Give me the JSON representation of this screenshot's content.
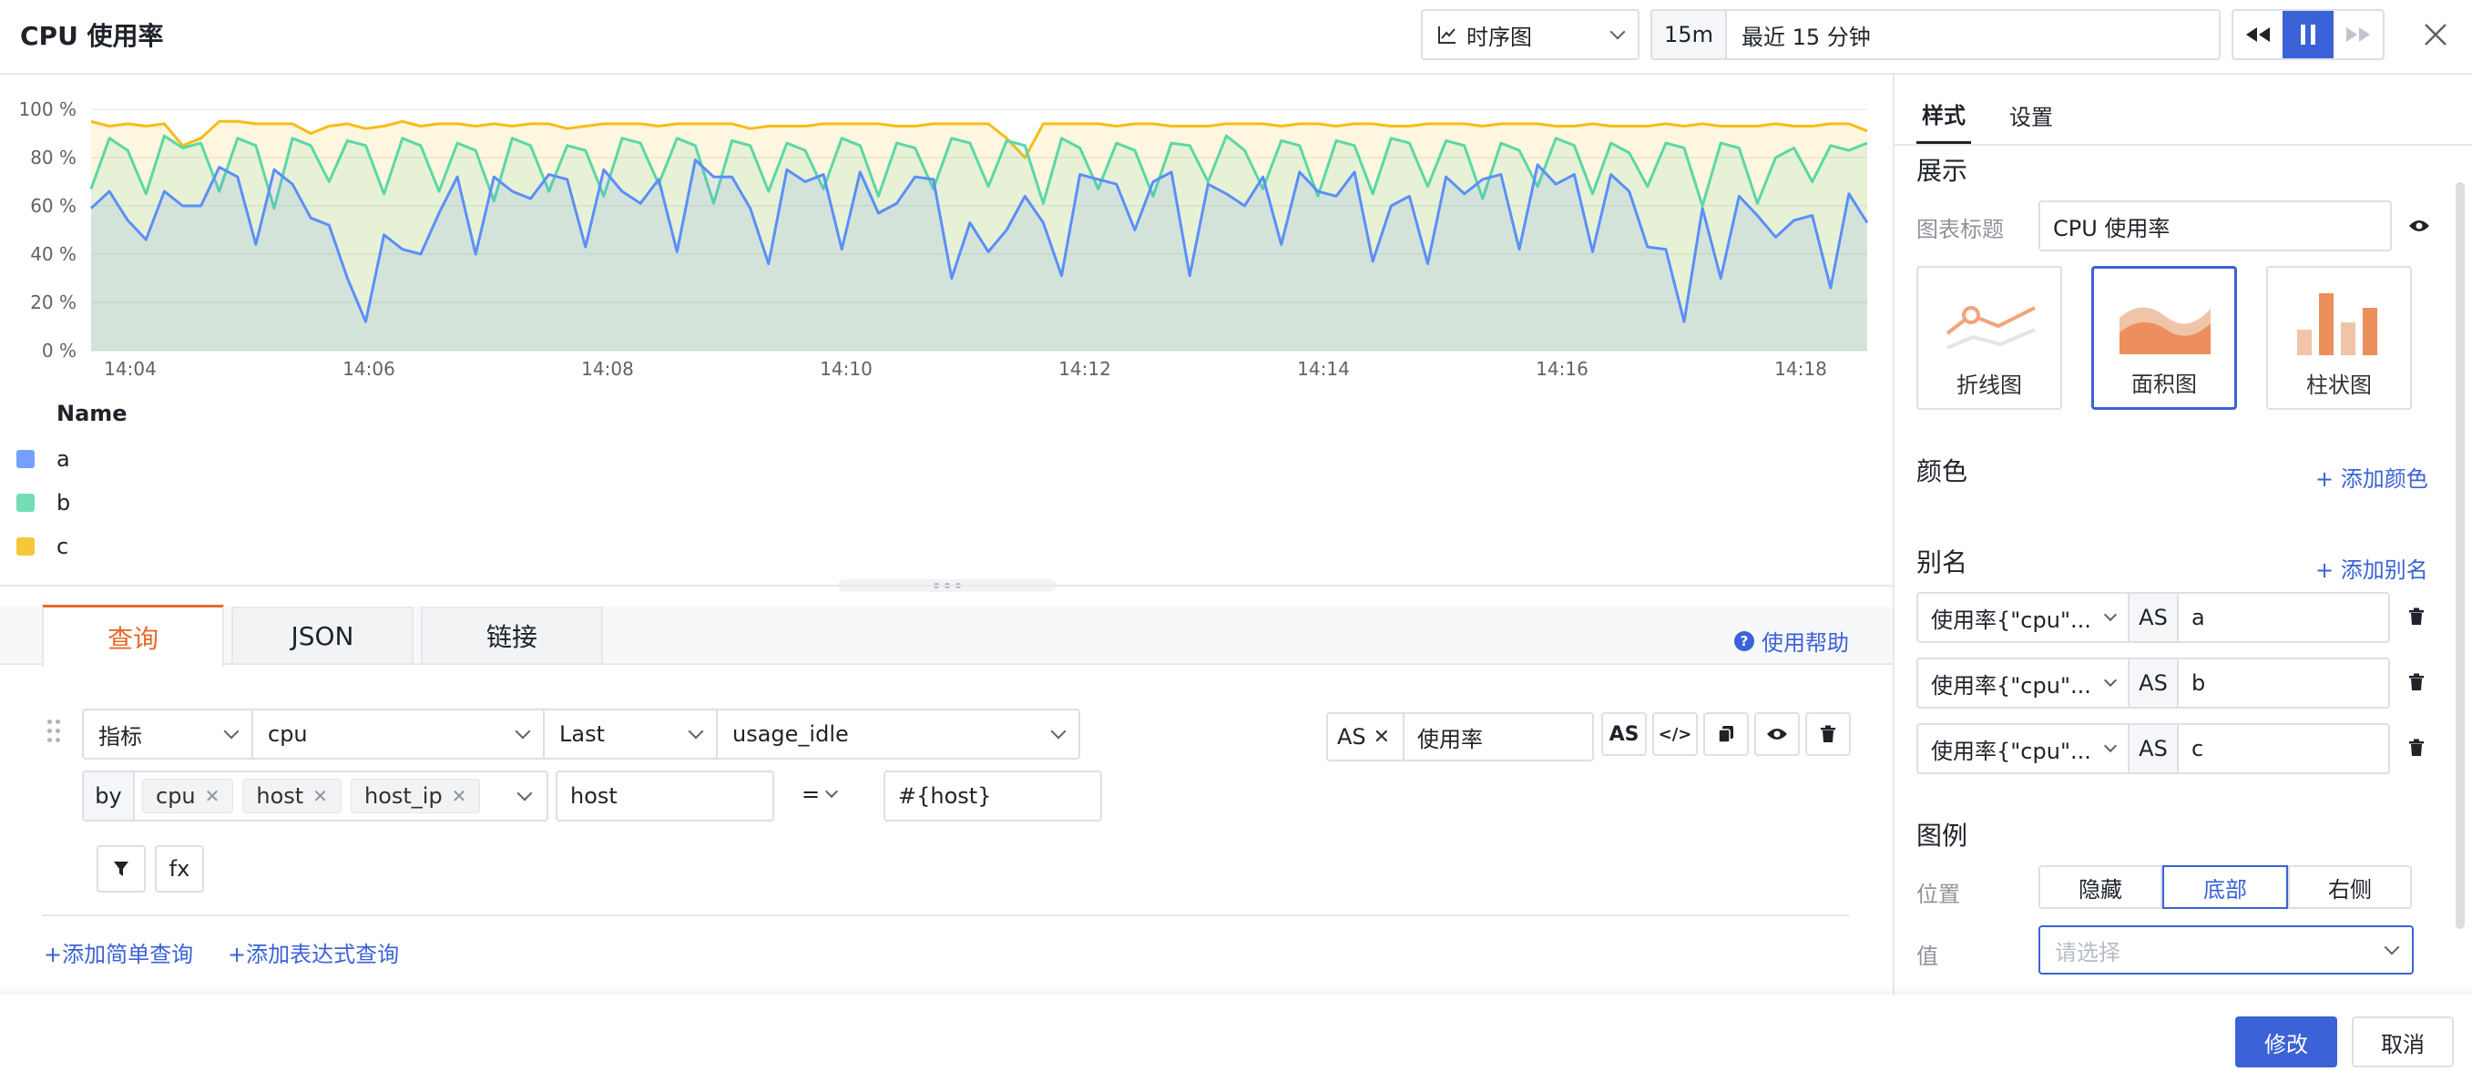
{
  "header": {
    "title": "CPU 使用率",
    "chart_type_select": "时序图",
    "time_range_short": "15m",
    "time_range_label": "最近 15 分钟"
  },
  "chart_data": {
    "type": "area",
    "x_ticks": [
      "14:04",
      "14:06",
      "14:08",
      "14:10",
      "14:12",
      "14:14",
      "14:16",
      "14:18"
    ],
    "y_ticks": [
      "0 %",
      "20 %",
      "40 %",
      "60 %",
      "80 %",
      "100 %"
    ],
    "ylim": [
      0,
      100
    ],
    "grid": true,
    "legend_title": "Name",
    "legend_position": "bottom",
    "series": [
      {
        "name": "a",
        "color": "#5b8ff9",
        "values": [
          59,
          66,
          54,
          46,
          66,
          60,
          60,
          76,
          72,
          44,
          75,
          69,
          55,
          52,
          30,
          12,
          48,
          42,
          40,
          57,
          72,
          40,
          72,
          66,
          63,
          73,
          71,
          43,
          75,
          66,
          61,
          71,
          41,
          79,
          72,
          72,
          59,
          36,
          75,
          70,
          73,
          42,
          74,
          57,
          61,
          72,
          71,
          30,
          53,
          41,
          50,
          64,
          53,
          31,
          73,
          71,
          69,
          50,
          70,
          74,
          31,
          69,
          65,
          60,
          72,
          44,
          74,
          66,
          64,
          74,
          37,
          60,
          64,
          36,
          72,
          65,
          71,
          73,
          42,
          77,
          69,
          73,
          41,
          73,
          66,
          43,
          42,
          12,
          59,
          30,
          64,
          56,
          47,
          54,
          56,
          26,
          65,
          53
        ]
      },
      {
        "name": "b",
        "color": "#5ad8a6",
        "values": [
          67,
          88,
          83,
          65,
          89,
          84,
          86,
          66,
          88,
          85,
          59,
          88,
          85,
          70,
          87,
          85,
          65,
          88,
          85,
          66,
          86,
          83,
          62,
          88,
          85,
          66,
          85,
          83,
          64,
          88,
          86,
          69,
          88,
          85,
          61,
          87,
          85,
          66,
          86,
          83,
          67,
          88,
          85,
          64,
          86,
          84,
          67,
          88,
          86,
          68,
          87,
          85,
          61,
          88,
          84,
          67,
          86,
          83,
          64,
          86,
          85,
          70,
          89,
          83,
          67,
          87,
          85,
          64,
          87,
          85,
          65,
          88,
          86,
          68,
          87,
          85,
          63,
          86,
          83,
          68,
          88,
          85,
          65,
          86,
          82,
          68,
          86,
          84,
          60,
          86,
          84,
          61,
          80,
          84,
          70,
          85,
          83,
          86
        ]
      },
      {
        "name": "c",
        "color": "#f6bd16",
        "values": [
          95,
          93,
          94,
          93,
          94,
          85,
          88,
          95,
          95,
          94,
          94,
          94,
          90,
          93,
          94,
          92,
          93,
          95,
          93,
          94,
          94,
          93,
          94,
          93,
          94,
          94,
          92,
          93,
          94,
          94,
          94,
          93,
          94,
          94,
          94,
          94,
          92,
          93,
          93,
          93,
          94,
          94,
          94,
          94,
          93,
          93,
          94,
          94,
          94,
          94,
          88,
          80,
          94,
          94,
          94,
          94,
          93,
          94,
          94,
          93,
          93,
          93,
          94,
          94,
          94,
          93,
          94,
          94,
          93,
          94,
          94,
          93,
          93,
          94,
          94,
          94,
          93,
          94,
          94,
          94,
          93,
          93,
          94,
          93,
          93,
          93,
          94,
          93,
          94,
          93,
          93,
          93,
          94,
          93,
          93,
          94,
          94,
          91
        ]
      }
    ]
  },
  "query": {
    "tabs": [
      "查询",
      "JSON",
      "链接"
    ],
    "help_link": "使用帮助",
    "type_select": "指标",
    "measurement_select": "cpu",
    "agg_select": "Last",
    "field_select": "usage_idle",
    "by_label": "by",
    "by_tags": [
      "cpu",
      "host",
      "host_ip"
    ],
    "filter_key": "host",
    "filter_op": "=",
    "filter_value": "#{host}",
    "as_label": "AS",
    "alias_value": "使用率",
    "as_button": "AS",
    "fx_label": "fx",
    "add_simple": "添加简单查询",
    "add_expr": "添加表达式查询"
  },
  "panel": {
    "tabs": [
      "样式",
      "设置"
    ],
    "display_section": "展示",
    "chart_title_label": "图表标题",
    "chart_title_value": "CPU 使用率",
    "chart_types": [
      "折线图",
      "面积图",
      "柱状图"
    ],
    "selected_chart_type": "面积图",
    "color_section": "颜色",
    "add_color": "添加颜色",
    "alias_section": "别名",
    "add_alias": "添加别名",
    "aliases": [
      {
        "source": "使用率{\"cpu\"...",
        "as": "AS",
        "value": "a"
      },
      {
        "source": "使用率{\"cpu\"...",
        "as": "AS",
        "value": "b"
      },
      {
        "source": "使用率{\"cpu\"...",
        "as": "AS",
        "value": "c"
      }
    ],
    "legend_section": "图例",
    "position_label": "位置",
    "position_options": [
      "隐藏",
      "底部",
      "右侧"
    ],
    "position_selected": "底部",
    "value_label": "值",
    "value_placeholder": "请选择"
  },
  "footer": {
    "confirm": "修改",
    "cancel": "取消"
  },
  "colors": {
    "accent": "#3b62d6",
    "active_tab": "#e8682d"
  }
}
